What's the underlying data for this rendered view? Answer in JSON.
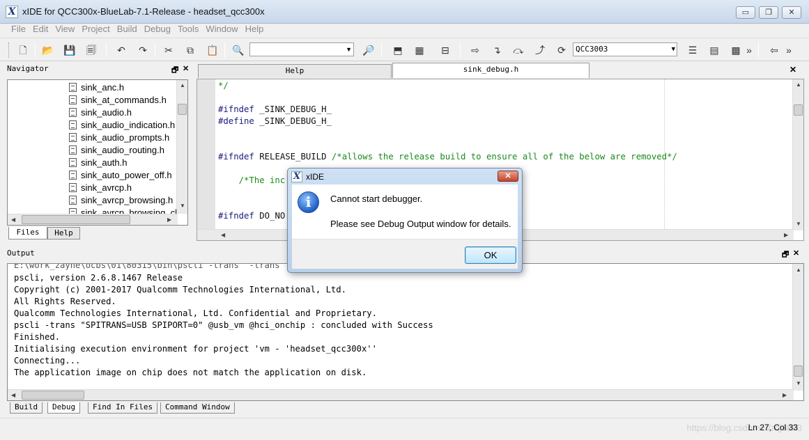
{
  "window": {
    "logo": "X",
    "title": "xIDE for QCC300x-BlueLab-7.1-Release - headset_qcc300x",
    "controls": {
      "minimize": "▭",
      "restore": "❐",
      "close": "✕"
    }
  },
  "menu": [
    "File",
    "Edit",
    "View",
    "Project",
    "Build",
    "Debug",
    "Tools",
    "Window",
    "Help"
  ],
  "toolbar": {
    "find_value": "",
    "chip_select": "QCC3003",
    "overflow_1": "»",
    "overflow_2": "»",
    "icons": [
      "new-file-icon",
      "open-folder-icon",
      "save-icon",
      "save-all-icon",
      "undo-icon",
      "redo-icon",
      "cut-icon",
      "copy-icon",
      "paste-icon",
      "find-icon",
      "find-in-files-icon",
      "build-icon",
      "rebuild-icon",
      "clean-icon",
      "run-icon",
      "step-into-icon",
      "step-over-icon",
      "step-out-icon",
      "step-icon",
      "disassembly-icon",
      "memory-icon",
      "registers-icon",
      "back-icon"
    ]
  },
  "navigator": {
    "title": "Navigator",
    "float": "🗗",
    "close": "✕",
    "files": [
      "sink_anc.h",
      "sink_at_commands.h",
      "sink_audio.h",
      "sink_audio_indication.h",
      "sink_audio_prompts.h",
      "sink_audio_routing.h",
      "sink_auth.h",
      "sink_auto_power_off.h",
      "sink_avrcp.h",
      "sink_avrcp_browsing.h",
      "sink_avrcp_browsing_cl"
    ],
    "tabs": [
      "Files",
      "Help"
    ]
  },
  "editor": {
    "tabs": [
      "Help",
      "sink_debug.h"
    ],
    "close": "✕",
    "lines": [
      [
        {
          "c": "cm",
          "t": "*/"
        }
      ],
      [],
      [
        {
          "c": "kw",
          "t": "#ifndef"
        },
        {
          "c": "id",
          "t": " _SINK_DEBUG_H_"
        }
      ],
      [
        {
          "c": "kw",
          "t": "#define"
        },
        {
          "c": "id",
          "t": " _SINK_DEBUG_H_"
        }
      ],
      [],
      [],
      [
        {
          "c": "kw",
          "t": "#ifndef"
        },
        {
          "c": "id",
          "t": " RELEASE_BUILD "
        },
        {
          "c": "cm",
          "t": "/*allows the release build to ensure all of the below are removed*/"
        }
      ],
      [],
      [
        {
          "c": "cm",
          "t": "    /*The inc"
        }
      ],
      [],
      [],
      [
        {
          "c": "kw",
          "t": "#ifndef"
        },
        {
          "c": "id",
          "t": " DO_NO"
        }
      ]
    ]
  },
  "output": {
    "title": "Output",
    "float": "🗗",
    "close": "✕",
    "lines": [
      "E:\\work_zayne\\ocbs\\01\\80315\\bin\\pscli -trans  -trans",
      "pscli, version 2.6.8.1467 Release",
      "Copyright (c) 2001-2017 Qualcomm Technologies International, Ltd.",
      "All Rights Reserved.",
      "Qualcomm Technologies International, Ltd. Confidential and Proprietary.",
      "pscli -trans \"SPITRANS=USB SPIPORT=0\" @usb_vm @hci_onchip : concluded with Success",
      "Finished.",
      "Initialising execution environment for project 'vm - 'headset_qcc300x''",
      "Connecting...",
      "The application image on chip does not match the application on disk."
    ],
    "tabs": [
      "Build",
      "Debug",
      "Find In Files",
      "Command Window"
    ]
  },
  "status": {
    "position": "Ln 27, Col 33",
    "watermark": "https://blog.csdn.net/zqj6893"
  },
  "dialog": {
    "logo": "X",
    "title": "xIDE",
    "close": "✕",
    "icon": "i",
    "message_1": "Cannot start debugger.",
    "message_2": "Please see Debug Output window for details.",
    "ok": "OK"
  }
}
